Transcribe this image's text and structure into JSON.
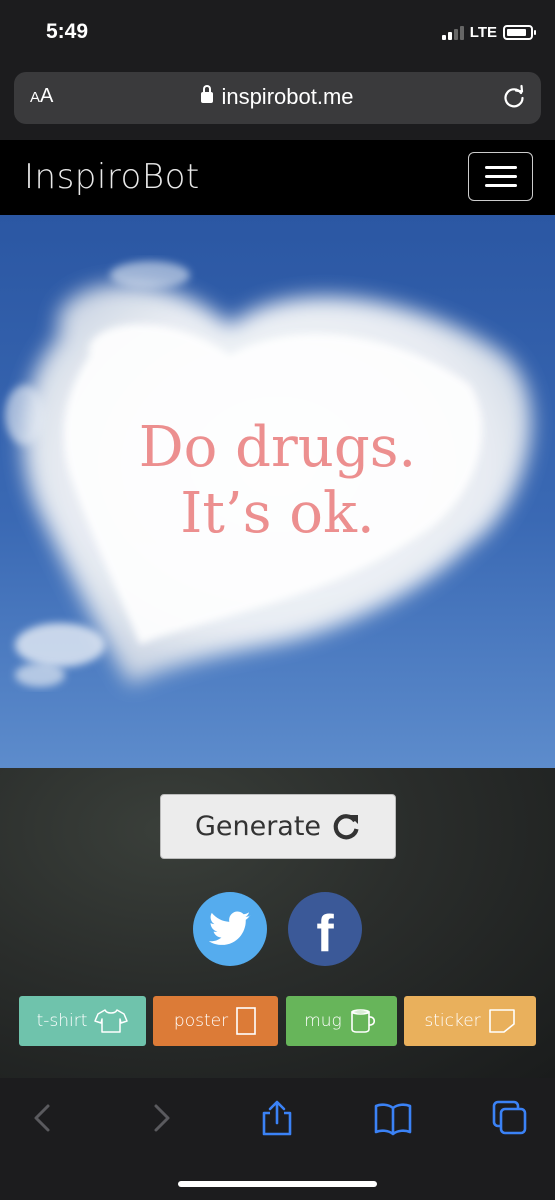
{
  "status_bar": {
    "time": "5:49",
    "network": "LTE",
    "signal_bars": 2,
    "battery_level": 0.85
  },
  "browser": {
    "text_size_label_small": "A",
    "text_size_label_large": "A",
    "url": "inspirobot.me"
  },
  "site": {
    "brand": "InspiroBot"
  },
  "hero": {
    "quote_line1": "Do drugs.",
    "quote_line2": "It’s ok.",
    "quote_color": "#ec8f8f"
  },
  "actions": {
    "generate_label": "Generate"
  },
  "shop": {
    "tshirt_label": "t-shirt",
    "poster_label": "poster",
    "mug_label": "mug",
    "sticker_label": "sticker"
  },
  "colors": {
    "twitter": "#55acee",
    "facebook": "#3b5998",
    "tshirt": "#6fc3ac",
    "poster": "#dc7b37",
    "mug": "#67b55a",
    "sticker": "#e9b05c",
    "ios_link": "#3b82f6"
  }
}
